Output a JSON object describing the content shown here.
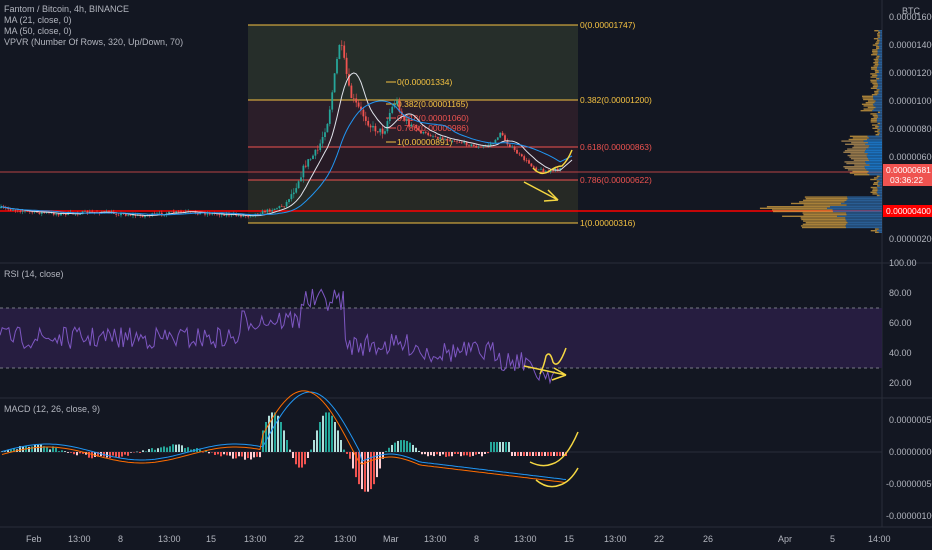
{
  "header": {
    "symbol_line": "Fantom / Bitcoin, 4h, BINANCE",
    "ma21": "MA (21, close, 0)",
    "ma50": "MA (50, close, 0)",
    "vpvr": "VPVR (Number Of Rows, 320, Up/Down, 70)",
    "currency": "BTC"
  },
  "price_axis": {
    "ticks": [
      "0.00001600",
      "0.00001400",
      "0.00001200",
      "0.00001000",
      "0.00000800",
      "0.00000600",
      "0.00000200"
    ],
    "current_price": "0.00000681",
    "countdown": "03:36:22",
    "support_price": "0.00000400"
  },
  "fib_main": [
    {
      "label": "0(0.00001747)",
      "color": "#f5c242"
    },
    {
      "label": "0.382(0.00001200)",
      "color": "#f5c242"
    },
    {
      "label": "0.618(0.00000863)",
      "color": "#ef5350"
    },
    {
      "label": "0.786(0.00000622)",
      "color": "#ef5350"
    },
    {
      "label": "1(0.00000316)",
      "color": "#f5c242"
    }
  ],
  "fib_small": [
    {
      "label": "0(0.00001334)",
      "color": "#f5c242"
    },
    {
      "label": "0.382(0.00001165)",
      "color": "#f5c242"
    },
    {
      "label": "0.618(0.00001060)",
      "color": "#ef5350"
    },
    {
      "label": "0.786(0.00000986)",
      "color": "#ef5350"
    },
    {
      "label": "1(0.00000891)",
      "color": "#f5c242"
    }
  ],
  "rsi": {
    "title": "RSI (14, close)",
    "ticks": [
      "100.00",
      "80.00",
      "60.00",
      "40.00",
      "20.00"
    ]
  },
  "macd": {
    "title": "MACD (12, 26, close, 9)",
    "ticks": [
      "0.00000050",
      "0.00000000",
      "-0.00000050",
      "-0.00000100"
    ]
  },
  "time_axis": [
    "Feb",
    "13:00",
    "8",
    "13:00",
    "15",
    "13:00",
    "22",
    "13:00",
    "Mar",
    "13:00",
    "8",
    "13:00",
    "15",
    "13:00",
    "22",
    "26",
    "Apr",
    "5",
    "14:00"
  ],
  "colors": {
    "background": "#131722",
    "up": "#26a69a",
    "down": "#ef5350",
    "ma21": "#e0e3eb",
    "ma50": "#2196f3",
    "fib_gold": "#f5c242",
    "annotation": "#f5d742",
    "rsi_line": "#7e57c2",
    "support_line": "#ff0000"
  },
  "chart_data": [
    {
      "type": "candlestick",
      "title": "Fantom / Bitcoin, 4h, BINANCE",
      "ylabel": "BTC",
      "ylim": [
        2.2e-06,
        1.79e-05
      ],
      "series": [
        {
          "name": "MA (21, close, 0)",
          "values": []
        },
        {
          "name": "MA (50, close, 0)",
          "values": []
        }
      ],
      "horizontal_levels": [
        4e-06,
        6.81e-06
      ],
      "fib_retracement": [
        1.747e-05,
        1.2e-05,
        8.63e-06,
        6.22e-06,
        3.16e-06
      ]
    },
    {
      "type": "line",
      "title": "RSI (14, close)",
      "ylim": [
        20,
        100
      ],
      "bands": [
        70,
        30
      ]
    },
    {
      "type": "bar",
      "title": "MACD (12, 26, close, 9)",
      "ylim": [
        -1.05e-06,
        6e-07
      ]
    }
  ]
}
